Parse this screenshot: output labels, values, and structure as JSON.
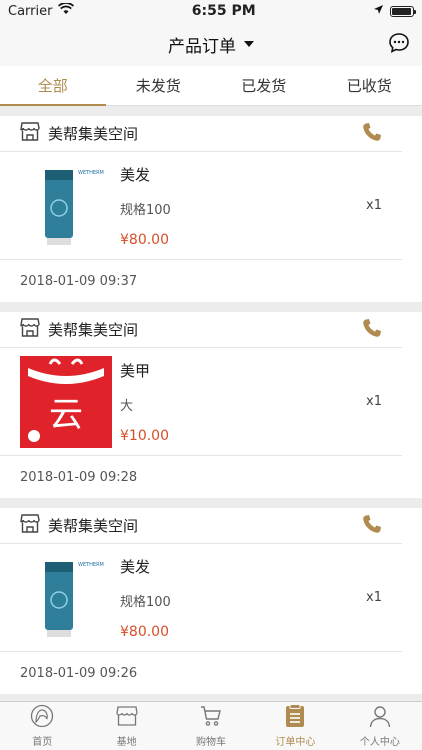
{
  "status_bar": {
    "carrier": "Carrier",
    "time": "6:55 PM",
    "battery_level": 0.95
  },
  "nav": {
    "title": "产品订单",
    "message_icon": "message-bubble-icon"
  },
  "tabs": [
    {
      "label": "全部",
      "active": true
    },
    {
      "label": "未发货",
      "active": false
    },
    {
      "label": "已发货",
      "active": false
    },
    {
      "label": "已收货",
      "active": false
    }
  ],
  "orders": [
    {
      "shop_name": "美帮集美空间",
      "item": {
        "name": "美发",
        "spec": "规格100",
        "price": "¥80.00",
        "qty": "x1",
        "thumb": "lotion-tube-image",
        "thumb_text": "WETHERM"
      },
      "time": "2018-01-09 09:37"
    },
    {
      "shop_name": "美帮集美空间",
      "item": {
        "name": "美甲",
        "spec": "大",
        "price": "¥10.00",
        "qty": "x1",
        "thumb": "yun-bag-image",
        "thumb_text": "云"
      },
      "time": "2018-01-09 09:28"
    },
    {
      "shop_name": "美帮集美空间",
      "item": {
        "name": "美发",
        "spec": "规格100",
        "price": "¥80.00",
        "qty": "x1",
        "thumb": "lotion-tube-image",
        "thumb_text": "WETHERM"
      },
      "time": "2018-01-09 09:26"
    }
  ],
  "tab_bar": [
    {
      "label": "首页",
      "icon": "home-avatar-icon",
      "active": false
    },
    {
      "label": "基地",
      "icon": "store-icon",
      "active": false
    },
    {
      "label": "购物车",
      "icon": "cart-icon",
      "active": false
    },
    {
      "label": "订单中心",
      "icon": "order-list-icon",
      "active": true
    },
    {
      "label": "个人中心",
      "icon": "person-icon",
      "active": false
    }
  ],
  "colors": {
    "accent": "#b08b4f",
    "price": "#d6502a",
    "background": "#ececec"
  }
}
